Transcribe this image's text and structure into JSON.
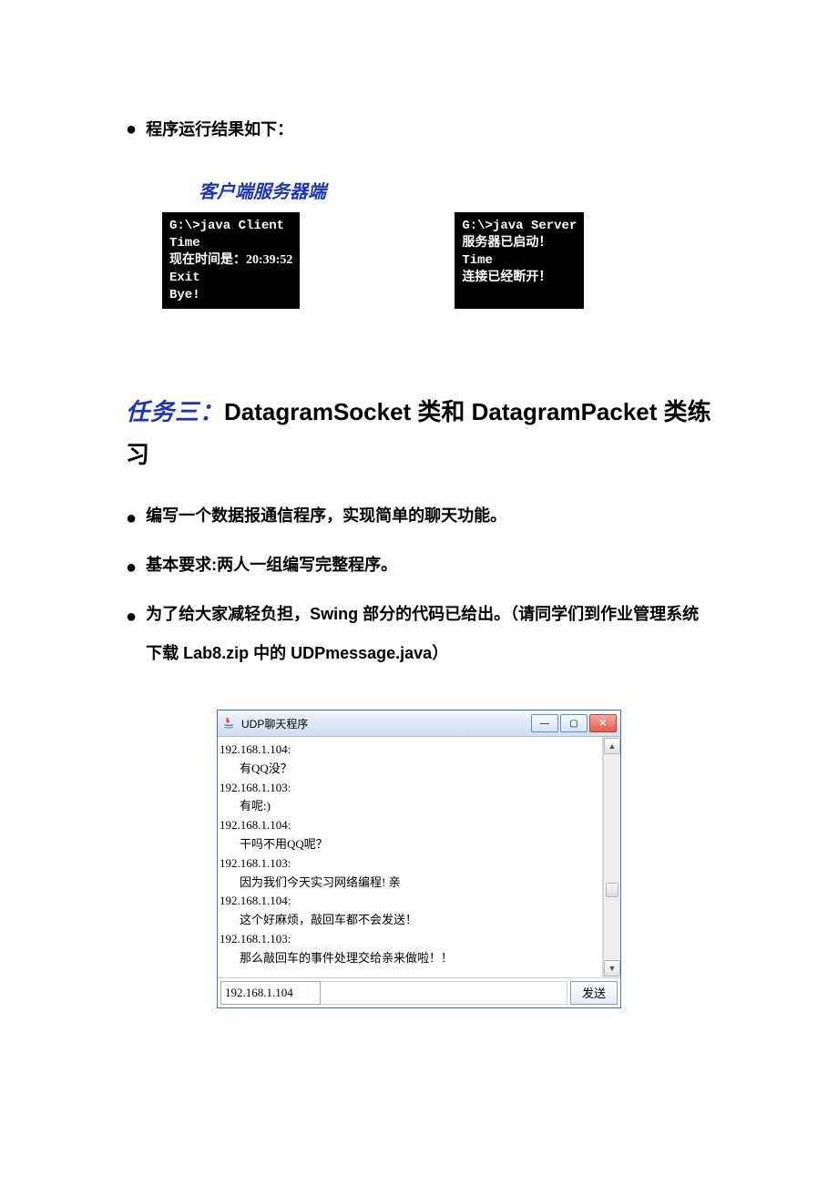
{
  "intro_bullet": "程序运行结果如下：",
  "labels": "客户端服务器端",
  "terminal_client": [
    "G:\\>java Client",
    "Time",
    "现在时间是：20:39:52",
    "Exit",
    "Bye!"
  ],
  "terminal_server": [
    "G:\\>java Server",
    "服务器已启动！",
    "Time",
    "连接已经断开！"
  ],
  "task": {
    "prefix": "任务三：",
    "title_rest": "DatagramSocket 类和 DatagramPacket 类练习"
  },
  "bullets": [
    "编写一个数据报通信程序，实现简单的聊天功能。",
    "基本要求:两人一组编写完整程序。",
    "为了给大家减轻负担，Swing 部分的代码已给出。（请同学们到作业管理系统下载 Lab8.zip 中的 UDPmessage.java）"
  ],
  "swing": {
    "title": "UDP聊天程序",
    "icons": {
      "java": "java-icon",
      "minimize": "—",
      "maximize": "▢",
      "close": "✕",
      "up": "▲",
      "down": "▼"
    },
    "chat": [
      {
        "ip": "192.168.1.104:",
        "msg": "有QQ没？"
      },
      {
        "ip": "192.168.1.103:",
        "msg": "有呢:)"
      },
      {
        "ip": "192.168.1.104:",
        "msg": "干吗不用QQ呢？"
      },
      {
        "ip": "192.168.1.103:",
        "msg": "因为我们今天实习网络编程! 亲"
      },
      {
        "ip": "192.168.1.104:",
        "msg": "这个好麻烦，敲回车都不会发送！"
      },
      {
        "ip": "192.168.1.103:",
        "msg": "那么敲回车的事件处理交给亲来做啦！！"
      }
    ],
    "ip_input": "192.168.1.104",
    "send": "发送"
  }
}
